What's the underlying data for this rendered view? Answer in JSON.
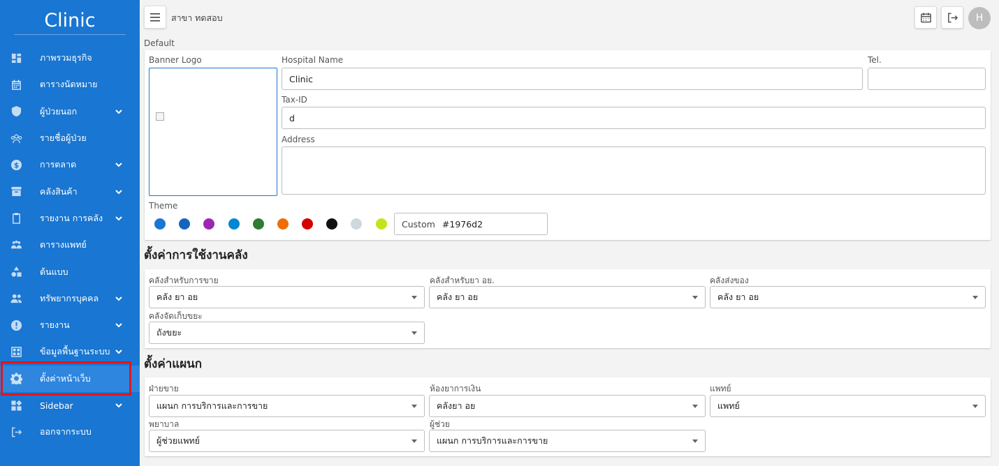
{
  "sidebar": {
    "brand": "Clinic",
    "items": [
      {
        "label": "ภาพรวมธุรกิจ",
        "icon": "dashboard-icon",
        "chevron": false
      },
      {
        "label": "ตารางนัดหมาย",
        "icon": "calendar-icon",
        "chevron": false
      },
      {
        "label": "ผู้ป่วยนอก",
        "icon": "shield-icon",
        "chevron": true
      },
      {
        "label": "รายชื่อผู้ป่วย",
        "icon": "people-icon",
        "chevron": false
      },
      {
        "label": "การตลาด",
        "icon": "dollar-icon",
        "chevron": true
      },
      {
        "label": "คลังสินค้า",
        "icon": "archive-icon",
        "chevron": true
      },
      {
        "label": "รายงาน การคลัง",
        "icon": "clipboard-icon",
        "chevron": true
      },
      {
        "label": "ตารางแพทย์",
        "icon": "doctors-icon",
        "chevron": false
      },
      {
        "label": "ต้นแบบ",
        "icon": "shapes-icon",
        "chevron": false
      },
      {
        "label": "ทรัพยากรบุคคล",
        "icon": "group-icon",
        "chevron": true
      },
      {
        "label": "รายงาน",
        "icon": "alert-icon",
        "chevron": true
      },
      {
        "label": "ข้อมูลพื้นฐานระบบ",
        "icon": "grid-icon",
        "chevron": true
      },
      {
        "label": "ตั้งค่าหน้าเว็บ",
        "icon": "gear-icon",
        "chevron": false,
        "active": true
      },
      {
        "label": "Sidebar",
        "icon": "widgets-icon",
        "chevron": true
      },
      {
        "label": "ออกจากระบบ",
        "icon": "logout-icon",
        "chevron": false
      }
    ]
  },
  "topbar": {
    "branch": "สาขา ทดสอบ",
    "avatar_initial": "H"
  },
  "default_section": {
    "label": "Default",
    "banner_logo_label": "Banner Logo",
    "hospital_name_label": "Hospital Name",
    "hospital_name_value": "Clinic",
    "tel_label": "Tel.",
    "tel_value": "",
    "tax_id_label": "Tax-ID",
    "tax_id_value": "d",
    "address_label": "Address",
    "address_value": "",
    "theme_label": "Theme",
    "theme_colors": [
      "#1976d2",
      "#1565c0",
      "#9c27b0",
      "#0288d1",
      "#2e7d32",
      "#ef6c00",
      "#d50000",
      "#111111",
      "#cfd8dc",
      "#c6e21b"
    ],
    "custom_label": "Custom",
    "custom_value": "#1976d2"
  },
  "warehouse_section": {
    "title": "ตั้งค่าการใช้งานคลัง",
    "fields": [
      {
        "label": "คลังสำหรับการขาย",
        "value": "คลัง ยา อย"
      },
      {
        "label": "คลังสำหรับยา อย.",
        "value": "คลัง ยา อย"
      },
      {
        "label": "คลังส่งของ",
        "value": "คลัง ยา อย"
      },
      {
        "label": "คลังจัดเก็บขยะ",
        "value": "ถังขยะ"
      }
    ]
  },
  "department_section": {
    "title": "ตั้งค่าแผนก",
    "fields": [
      {
        "label": "ฝ่ายขาย",
        "value": "แผนก การบริการและการขาย"
      },
      {
        "label": "ห้องยาการเงิน",
        "value": "คลังยา อย"
      },
      {
        "label": "แพทย์",
        "value": "แพทย์"
      },
      {
        "label": "พยาบาล",
        "value": "ผู้ช่วยแพทย์"
      },
      {
        "label": "ผู้ช่วย",
        "value": "แผนก การบริการและการขาย"
      }
    ]
  }
}
